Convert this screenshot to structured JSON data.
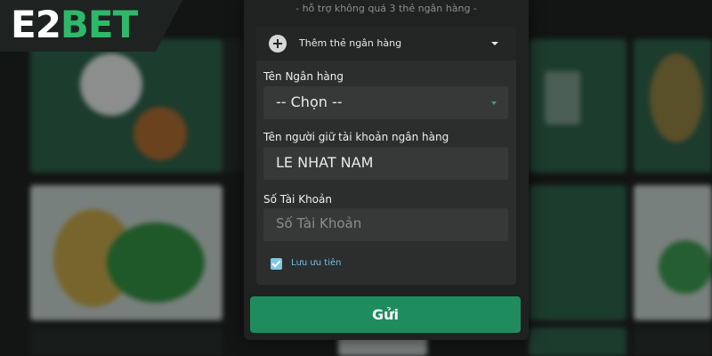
{
  "brand": {
    "part1": "E2",
    "part2": "BET"
  },
  "form": {
    "support_note": "- hỗ trợ không quá 3 thẻ ngân hàng -",
    "add_card_label": "Thêm thẻ ngân hàng",
    "bank_name": {
      "label": "Tên Ngân hàng",
      "selected": "-- Chọn --"
    },
    "account_holder": {
      "label": "Tên người giữ tài khoản ngân hàng",
      "value": "LE NHAT NAM"
    },
    "account_number": {
      "label": "Số Tài Khoản",
      "placeholder": "Số Tài Khoản"
    },
    "priority": {
      "label": "Lưu ưu tiên",
      "checked": true
    },
    "submit_label": "Gửi"
  },
  "colors": {
    "brand_green": "#2fb86a",
    "submit_green": "#1f8c5f",
    "checkbox_blue": "#7ec8e6"
  }
}
